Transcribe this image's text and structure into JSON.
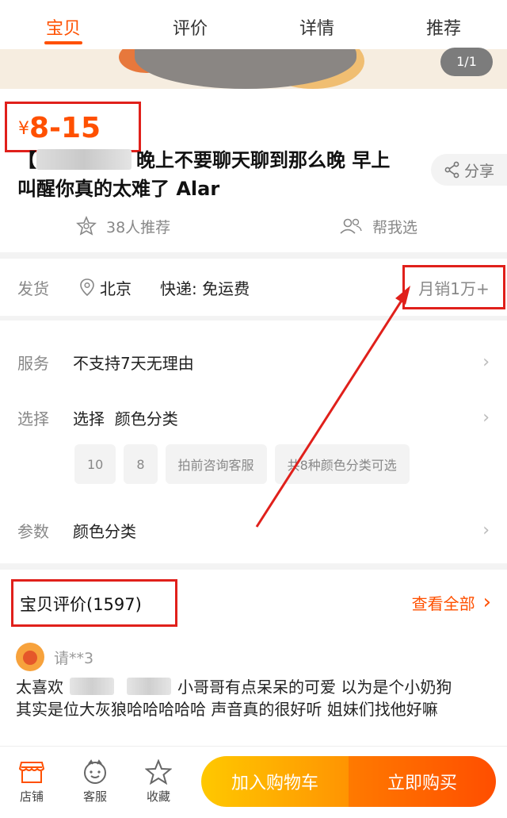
{
  "tabs": [
    {
      "label": "宝贝",
      "active": true
    },
    {
      "label": "评价",
      "active": false
    },
    {
      "label": "详情",
      "active": false
    },
    {
      "label": "推荐",
      "active": false
    }
  ],
  "gallery": {
    "counter": "1/1"
  },
  "product": {
    "currency": "¥",
    "price": "8-15",
    "title_prefix": "【",
    "title_line1": "晚上不要聊天聊到那么晚 早上",
    "title_line2": "叫醒你真的太难了 Alar",
    "share_label": "分享",
    "recommend_count": "38人推荐",
    "help_choose": "帮我选"
  },
  "shipping": {
    "label": "发货",
    "city": "北京",
    "express": "快递: 免运费",
    "monthly_sales": "月销1万+"
  },
  "options": {
    "service_label": "服务",
    "service_value": "不支持7天无理由",
    "select_label": "选择",
    "select_value": "选择  颜色分类",
    "chips": [
      "10",
      "8",
      "拍前咨询客服",
      "共8种颜色分类可选"
    ],
    "params_label": "参数",
    "params_value": "颜色分类"
  },
  "reviews": {
    "title": "宝贝评价(1597)",
    "see_all": "查看全部",
    "reviewer": "请**3",
    "text_part1": "太喜欢",
    "text_part2": "小哥哥有点呆呆的可爱  以为是个小奶狗",
    "text_line2": "其实是位大灰狼哈哈哈哈哈 声音真的很好听 姐妹们找他好嘛"
  },
  "bottom_bar": {
    "shop": "店铺",
    "service": "客服",
    "favorite": "收藏",
    "add_cart": "加入购物车",
    "buy_now": "立即购买"
  },
  "colors": {
    "accent": "#ff5000",
    "annotation": "#e0201b"
  }
}
